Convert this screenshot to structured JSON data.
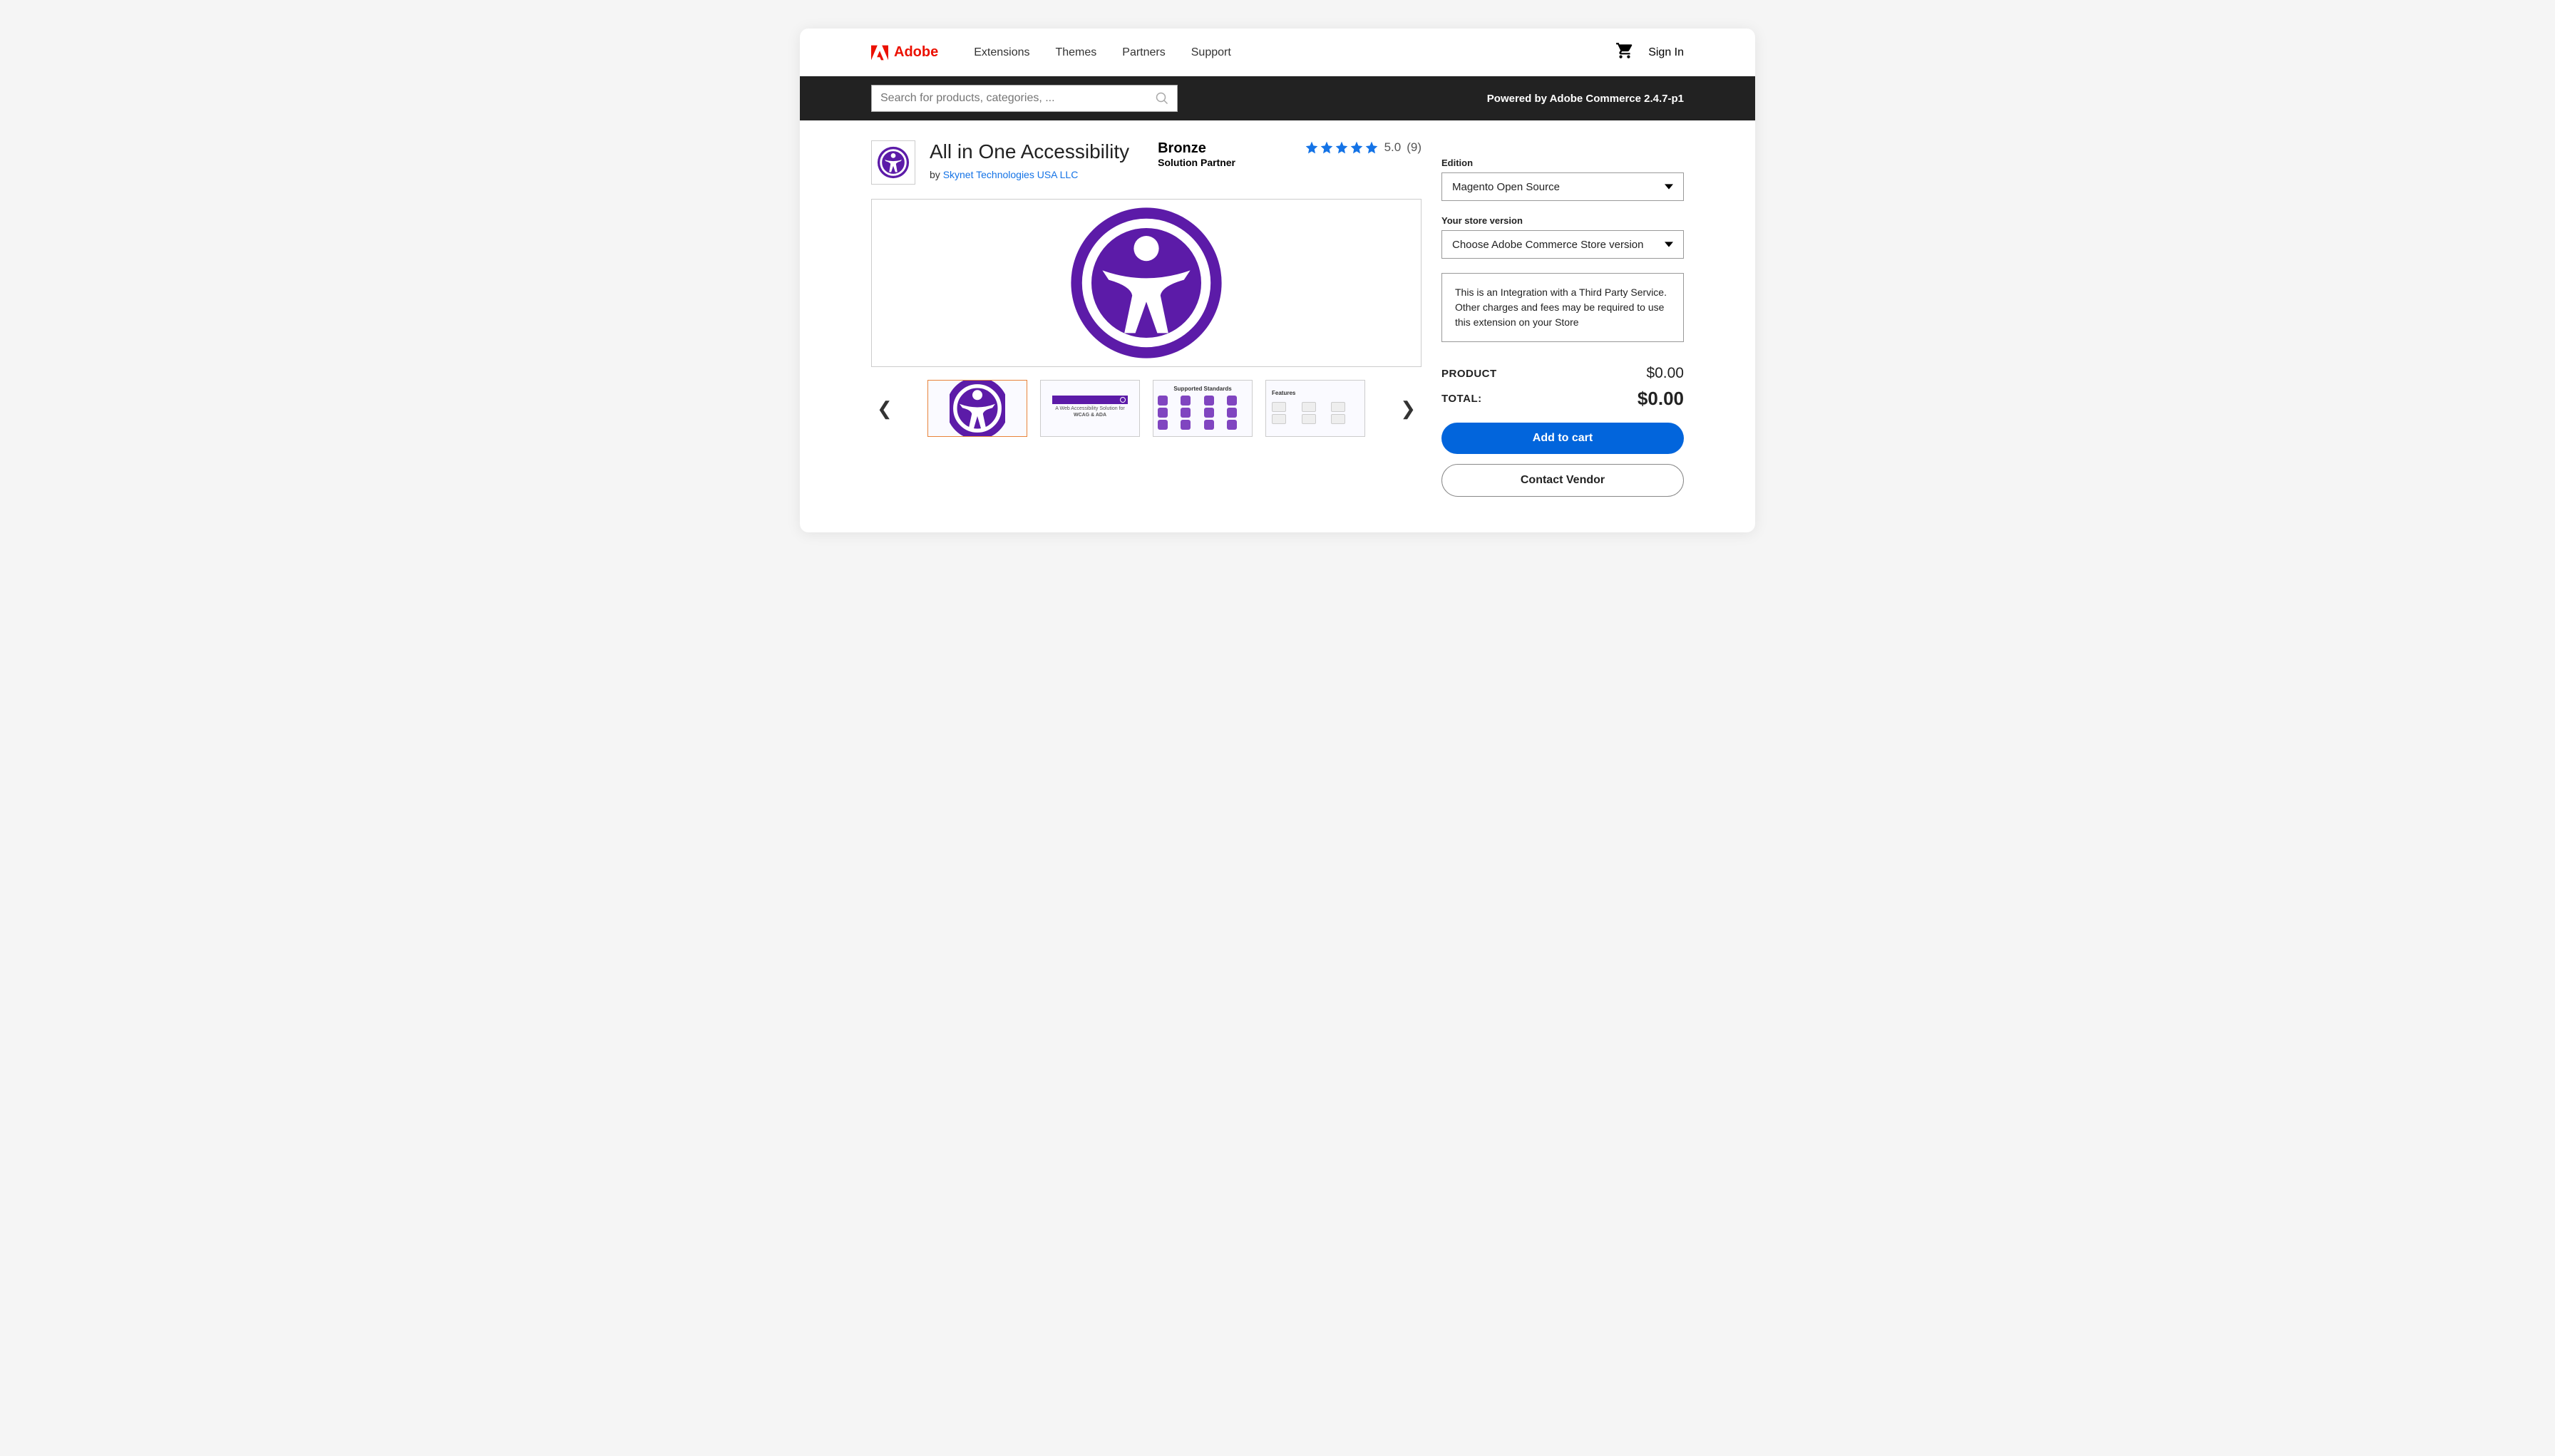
{
  "header": {
    "brand": "Adobe",
    "nav": [
      "Extensions",
      "Themes",
      "Partners",
      "Support"
    ],
    "signin": "Sign In"
  },
  "blackbar": {
    "search_placeholder": "Search for products, categories, ...",
    "powered": "Powered by Adobe Commerce 2.4.7-p1"
  },
  "product": {
    "title": "All in One Accessibility",
    "by": "by ",
    "vendor": "Skynet Technologies USA LLC",
    "partner_tier": "Bronze",
    "partner_sub": "Solution Partner",
    "rating_value": "5.0",
    "rating_count": "(9)"
  },
  "thumbs": {
    "t2_line1": "A Web Accessibility Solution for",
    "t2_line2": "WCAG & ADA",
    "t3_hdr": "Supported Standards",
    "t4_hdr": "Features"
  },
  "sidebar": {
    "edition_label": "Edition",
    "edition_value": "Magento Open Source",
    "version_label": "Your store version",
    "version_value": "Choose Adobe Commerce Store version",
    "notice": "This is an Integration with a Third Party Service. Other charges and fees may be required to use this extension on your Store",
    "product_label": "PRODUCT",
    "product_price": "$0.00",
    "total_label": "TOTAL:",
    "total_price": "$0.00",
    "add_to_cart": "Add to cart",
    "contact_vendor": "Contact Vendor"
  }
}
